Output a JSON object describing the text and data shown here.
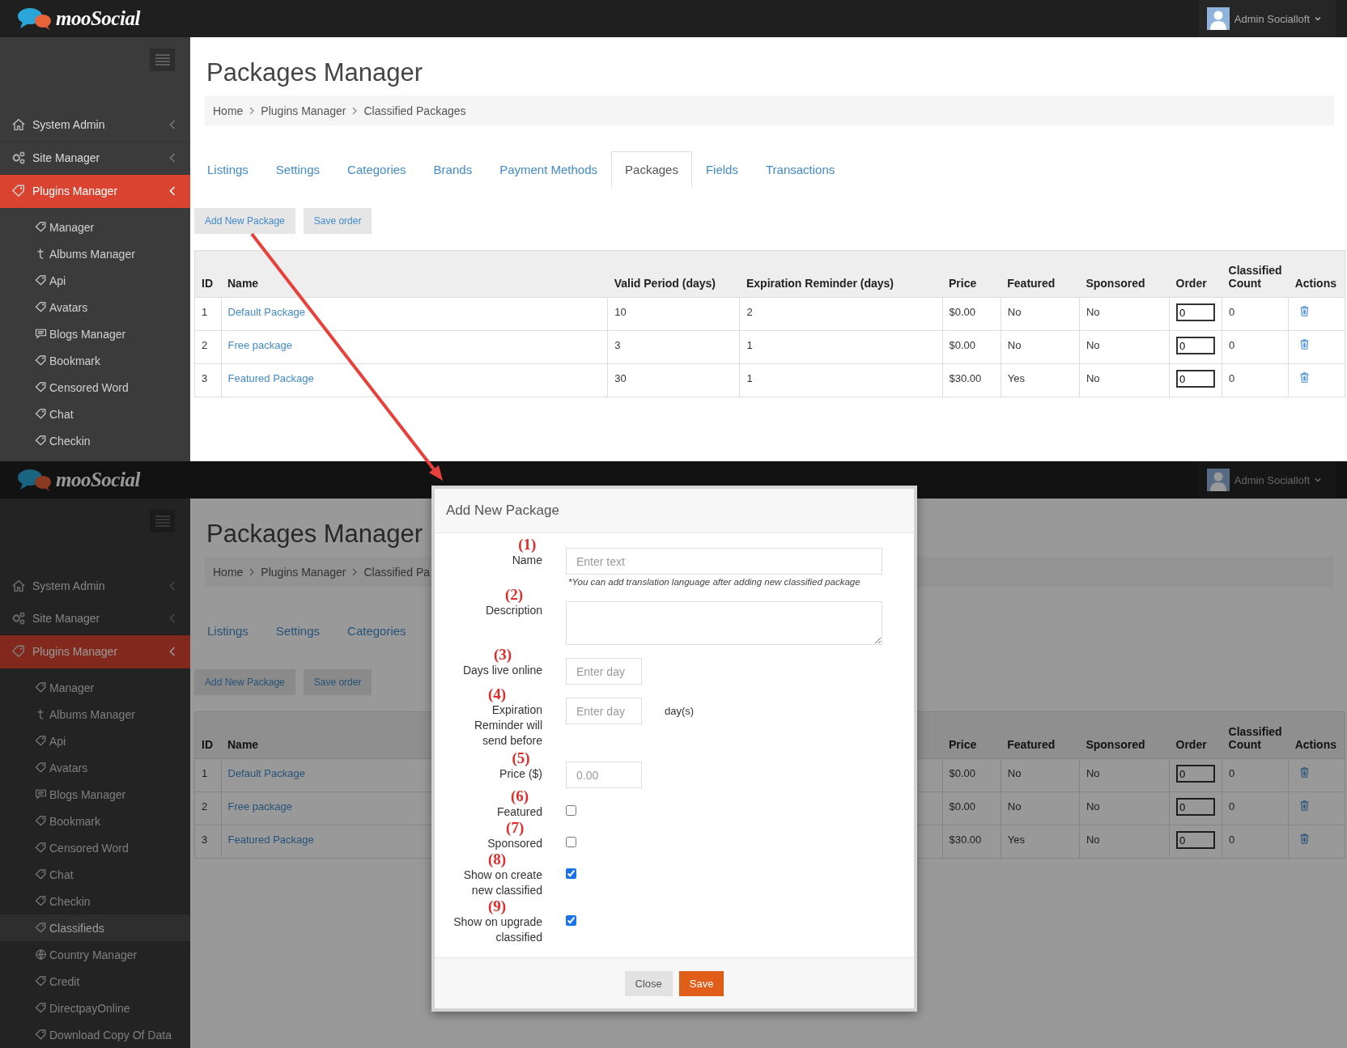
{
  "screens": [
    {
      "dimmed": false,
      "header": {
        "logo": "mooSocial",
        "user": "Admin Socialloft"
      },
      "sidebar": {
        "items": [
          {
            "label": "System Admin",
            "kind": "home",
            "selected": false
          },
          {
            "label": "Site Manager",
            "kind": "gears",
            "selected": false
          },
          {
            "label": "Plugins Manager",
            "kind": "plugin",
            "selected": true
          }
        ],
        "subitems": [
          {
            "label": "Manager",
            "kind": "plugin",
            "selected": false
          },
          {
            "label": "Albums Manager",
            "kind": "album",
            "selected": false
          },
          {
            "label": "Api",
            "kind": "plugin",
            "selected": false
          },
          {
            "label": "Avatars",
            "kind": "plugin",
            "selected": false
          },
          {
            "label": "Blogs Manager",
            "kind": "blog",
            "selected": false
          },
          {
            "label": "Bookmark",
            "kind": "plugin",
            "selected": false
          },
          {
            "label": "Censored Word",
            "kind": "plugin",
            "selected": false
          },
          {
            "label": "Chat",
            "kind": "plugin",
            "selected": false
          },
          {
            "label": "Checkin",
            "kind": "plugin",
            "selected": false
          }
        ]
      },
      "page": {
        "title": "Packages Manager",
        "breadcrumb": [
          "Home",
          "Plugins Manager",
          "Classified Packages"
        ],
        "tabs": [
          {
            "label": "Listings",
            "selected": false
          },
          {
            "label": "Settings",
            "selected": false
          },
          {
            "label": "Categories",
            "selected": false
          },
          {
            "label": "Brands",
            "selected": false
          },
          {
            "label": "Payment Methods",
            "selected": false
          },
          {
            "label": "Packages",
            "selected": true
          },
          {
            "label": "Fields",
            "selected": false
          },
          {
            "label": "Transactions",
            "selected": false
          }
        ],
        "buttons": [
          {
            "label": "Add New Package"
          },
          {
            "label": "Save order"
          }
        ],
        "table": {
          "columns": [
            {
              "label": "ID",
              "kind": "id"
            },
            {
              "label": "Name",
              "kind": "link"
            },
            {
              "label": "Valid Period (days)",
              "kind": "text"
            },
            {
              "label": "Expiration Reminder (days)",
              "kind": "wide"
            },
            {
              "label": "Price",
              "kind": "text"
            },
            {
              "label": "Featured",
              "kind": "text"
            },
            {
              "label": "Sponsored",
              "kind": "text"
            },
            {
              "label": "Order",
              "kind": "input"
            },
            {
              "label": "Classified Count",
              "kind": "count"
            },
            {
              "label": "Actions",
              "kind": "action"
            }
          ],
          "rows": [
            {
              "cells": [
                "1",
                "Default Package",
                "10",
                "2",
                "$0.00",
                "No",
                "No",
                "0",
                "0"
              ]
            },
            {
              "cells": [
                "2",
                "Free package",
                "3",
                "1",
                "$0.00",
                "No",
                "No",
                "0",
                "0"
              ]
            },
            {
              "cells": [
                "3",
                "Featured Package",
                "30",
                "1",
                "$30.00",
                "Yes",
                "No",
                "0",
                "0"
              ]
            }
          ]
        }
      }
    },
    {
      "dimmed": true,
      "header": {
        "logo": "mooSocial",
        "user": "Admin Socialloft"
      },
      "sidebar": {
        "items": [
          {
            "label": "System Admin",
            "kind": "home",
            "selected": false
          },
          {
            "label": "Site Manager",
            "kind": "gears",
            "selected": false
          },
          {
            "label": "Plugins Manager",
            "kind": "plugin",
            "selected": true
          }
        ],
        "subitems": [
          {
            "label": "Manager",
            "kind": "plugin",
            "selected": false
          },
          {
            "label": "Albums Manager",
            "kind": "album",
            "selected": false
          },
          {
            "label": "Api",
            "kind": "plugin",
            "selected": false
          },
          {
            "label": "Avatars",
            "kind": "plugin",
            "selected": false
          },
          {
            "label": "Blogs Manager",
            "kind": "blog",
            "selected": false
          },
          {
            "label": "Bookmark",
            "kind": "plugin",
            "selected": false
          },
          {
            "label": "Censored Word",
            "kind": "plugin",
            "selected": false
          },
          {
            "label": "Chat",
            "kind": "plugin",
            "selected": false
          },
          {
            "label": "Checkin",
            "kind": "plugin",
            "selected": false
          },
          {
            "label": "Classifieds",
            "kind": "plugin",
            "selected": true
          },
          {
            "label": "Country Manager",
            "kind": "globe",
            "selected": false
          },
          {
            "label": "Credit",
            "kind": "plugin",
            "selected": false
          },
          {
            "label": "DirectpayOnline",
            "kind": "plugin",
            "selected": false
          },
          {
            "label": "Download Copy Of Data",
            "kind": "plugin",
            "selected": false
          }
        ]
      },
      "page": {
        "title": "Packages Manager",
        "breadcrumb": [
          "Home",
          "Plugins Manager",
          "Classified Pa"
        ],
        "tabs": [
          {
            "label": "Listings",
            "selected": false
          },
          {
            "label": "Settings",
            "selected": false
          },
          {
            "label": "Categories",
            "selected": false
          }
        ],
        "buttons": [
          {
            "label": "Add New Package"
          },
          {
            "label": "Save order"
          }
        ],
        "table": {
          "columns": [
            {
              "label": "ID",
              "kind": "id"
            },
            {
              "label": "Name",
              "kind": "link"
            },
            {
              "label": "Price",
              "kind": "text"
            },
            {
              "label": "Featured",
              "kind": "text"
            },
            {
              "label": "Sponsored",
              "kind": "text"
            },
            {
              "label": "Order",
              "kind": "input"
            },
            {
              "label": "Classified Count",
              "kind": "count"
            },
            {
              "label": "Actions",
              "kind": "action"
            }
          ],
          "rows": [
            {
              "cells": [
                "1",
                "Default Package",
                "$0.00",
                "No",
                "No",
                "0",
                "0"
              ]
            },
            {
              "cells": [
                "2",
                "Free package",
                "$0.00",
                "No",
                "No",
                "0",
                "0"
              ]
            },
            {
              "cells": [
                "3",
                "Featured Package",
                "$30.00",
                "Yes",
                "No",
                "0",
                "0"
              ]
            }
          ]
        }
      },
      "modal": {
        "title": "Add New Package",
        "fields": [
          {
            "marker": "(1)",
            "label": "Name",
            "kind": "text",
            "placeholder": "Enter text",
            "hint": "*You can add translation language after adding new classified package"
          },
          {
            "marker": "(2)",
            "label": "Description",
            "kind": "textarea"
          },
          {
            "marker": "(3)",
            "label": "Days live online",
            "kind": "short",
            "placeholder": "Enter day"
          },
          {
            "marker": "(4)",
            "label": "Expiration Reminder will send before",
            "kind": "short",
            "placeholder": "Enter day",
            "suffix": "day(s)"
          },
          {
            "marker": "(5)",
            "label": "Price ($)",
            "kind": "short",
            "placeholder": "0.00"
          },
          {
            "marker": "(6)",
            "label": "Featured",
            "kind": "checkbox",
            "checked": false
          },
          {
            "marker": "(7)",
            "label": "Sponsored",
            "kind": "checkbox",
            "checked": false
          },
          {
            "marker": "(8)",
            "label": "Show on create new classified",
            "kind": "checkbox",
            "checked": true
          },
          {
            "marker": "(9)",
            "label": "Show on upgrade classified",
            "kind": "checkbox",
            "checked": true
          }
        ],
        "buttons": [
          {
            "label": "Close",
            "kind": "default"
          },
          {
            "label": "Save",
            "kind": "primary"
          }
        ]
      }
    }
  ]
}
